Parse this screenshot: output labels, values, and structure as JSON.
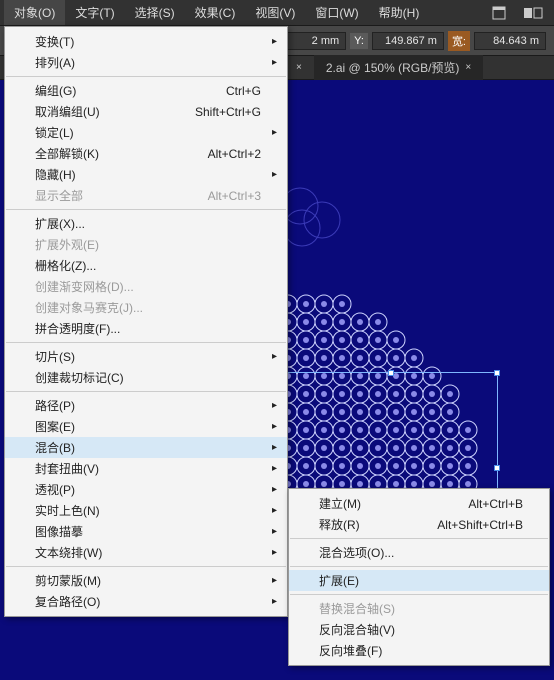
{
  "menubar": {
    "items": [
      "对象(O)",
      "文字(T)",
      "选择(S)",
      "效果(C)",
      "视图(V)",
      "窗口(W)",
      "帮助(H)"
    ],
    "active_index": 0
  },
  "toolbar": {
    "x_suffix": "2 mm",
    "y_label": "Y:",
    "y_value": "149.867 m",
    "w_label": "宽:",
    "w_value": "84.643 m"
  },
  "tabs": {
    "items": [
      {
        "label": "2.ai @ 150% (RGB/预览)",
        "active": true
      }
    ],
    "close_glyph": "×"
  },
  "menu_main": {
    "groups": [
      [
        {
          "label": "变换(T)",
          "sub": true
        },
        {
          "label": "排列(A)",
          "sub": true
        }
      ],
      [
        {
          "label": "编组(G)",
          "shortcut": "Ctrl+G"
        },
        {
          "label": "取消编组(U)",
          "shortcut": "Shift+Ctrl+G"
        },
        {
          "label": "锁定(L)",
          "sub": true
        },
        {
          "label": "全部解锁(K)",
          "shortcut": "Alt+Ctrl+2"
        },
        {
          "label": "隐藏(H)",
          "sub": true
        },
        {
          "label": "显示全部",
          "shortcut": "Alt+Ctrl+3",
          "disabled": true
        }
      ],
      [
        {
          "label": "扩展(X)..."
        },
        {
          "label": "扩展外观(E)",
          "disabled": true
        },
        {
          "label": "栅格化(Z)..."
        },
        {
          "label": "创建渐变网格(D)...",
          "disabled": true
        },
        {
          "label": "创建对象马赛克(J)...",
          "disabled": true
        },
        {
          "label": "拼合透明度(F)..."
        }
      ],
      [
        {
          "label": "切片(S)",
          "sub": true
        },
        {
          "label": "创建裁切标记(C)"
        }
      ],
      [
        {
          "label": "路径(P)",
          "sub": true
        },
        {
          "label": "图案(E)",
          "sub": true
        },
        {
          "label": "混合(B)",
          "sub": true,
          "hover": true
        },
        {
          "label": "封套扭曲(V)",
          "sub": true
        },
        {
          "label": "透视(P)",
          "sub": true
        },
        {
          "label": "实时上色(N)",
          "sub": true
        },
        {
          "label": "图像描摹",
          "sub": true
        },
        {
          "label": "文本绕排(W)",
          "sub": true
        }
      ],
      [
        {
          "label": "剪切蒙版(M)",
          "sub": true
        },
        {
          "label": "复合路径(O)",
          "sub": true
        }
      ]
    ]
  },
  "menu_sub": {
    "groups": [
      [
        {
          "label": "建立(M)",
          "shortcut": "Alt+Ctrl+B"
        },
        {
          "label": "释放(R)",
          "shortcut": "Alt+Shift+Ctrl+B"
        }
      ],
      [
        {
          "label": "混合选项(O)..."
        }
      ],
      [
        {
          "label": "扩展(E)",
          "hover": true
        }
      ],
      [
        {
          "label": "替换混合轴(S)",
          "disabled": true
        },
        {
          "label": "反向混合轴(V)"
        },
        {
          "label": "反向堆叠(F)"
        }
      ]
    ]
  }
}
